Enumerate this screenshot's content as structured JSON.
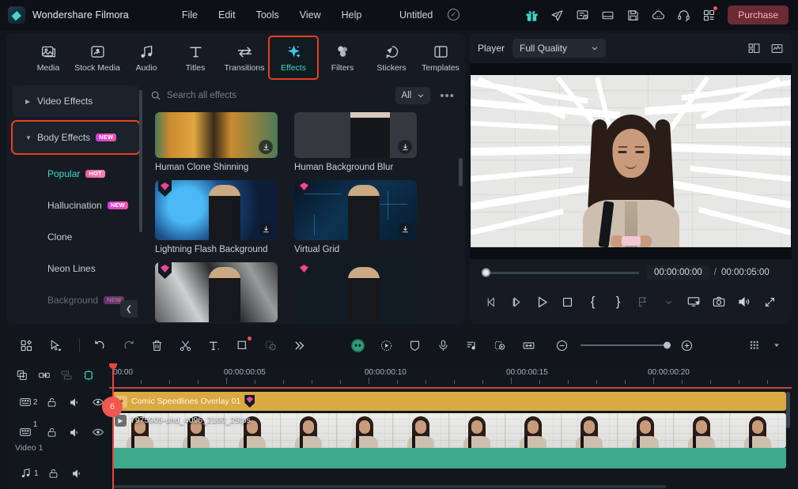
{
  "app": {
    "brand": "Wondershare Filmora",
    "logo_icon": "filmora-logo-icon",
    "menu": [
      "File",
      "Edit",
      "Tools",
      "View",
      "Help"
    ],
    "project_title": "Untitled",
    "project_saved_icon": "check-circle-icon",
    "top_icons": [
      {
        "name": "gift-icon",
        "label": "Gift"
      },
      {
        "name": "send-icon",
        "label": "Send"
      },
      {
        "name": "task-list-icon",
        "label": "Tasks"
      },
      {
        "name": "layout-icon",
        "label": "Layout"
      },
      {
        "name": "save-icon",
        "label": "Save"
      },
      {
        "name": "cloud-sync-icon",
        "label": "Cloud"
      },
      {
        "name": "headset-support-icon",
        "label": "Support"
      },
      {
        "name": "apps-grid-icon",
        "label": "More"
      }
    ],
    "purchase_label": "Purchase"
  },
  "tabs": [
    {
      "label": "Media",
      "icon": "media-icon",
      "active": false
    },
    {
      "label": "Stock Media",
      "icon": "stock-media-icon",
      "active": false
    },
    {
      "label": "Audio",
      "icon": "audio-icon",
      "active": false
    },
    {
      "label": "Titles",
      "icon": "titles-icon",
      "active": false
    },
    {
      "label": "Transitions",
      "icon": "transitions-icon",
      "active": false
    },
    {
      "label": "Effects",
      "icon": "effects-icon",
      "active": true
    },
    {
      "label": "Filters",
      "icon": "filters-icon",
      "active": false
    },
    {
      "label": "Stickers",
      "icon": "stickers-icon",
      "active": false
    },
    {
      "label": "Templates",
      "icon": "templates-icon",
      "active": false
    }
  ],
  "categories": [
    {
      "label": "Video Effects",
      "badge": "",
      "type": "group",
      "expanded": false
    },
    {
      "label": "Body Effects",
      "badge": "NEW",
      "type": "group",
      "expanded": true,
      "highlighted": true
    },
    {
      "label": "Popular",
      "badge": "HOT",
      "type": "sub",
      "selected": true
    },
    {
      "label": "Hallucination",
      "badge": "NEW",
      "type": "sub",
      "selected": false
    },
    {
      "label": "Clone",
      "badge": "",
      "type": "sub",
      "selected": false
    },
    {
      "label": "Neon Lines",
      "badge": "",
      "type": "sub",
      "selected": false
    },
    {
      "label": "Background",
      "badge": "NEW",
      "type": "sub",
      "selected": false
    }
  ],
  "collapse_icon": "chevron-left-icon",
  "search": {
    "placeholder": "Search all effects",
    "value": "",
    "icon": "search-icon",
    "filter_label": "All",
    "filter_caret": "chevron-down-icon",
    "more_label": "•••"
  },
  "effects": [
    {
      "name": "Human Clone Shinning",
      "thumb": "t-clone",
      "pro": false,
      "download": true
    },
    {
      "name": "Human Background Blur",
      "thumb": "t-blur",
      "pro": false,
      "download": true
    },
    {
      "name": "Lightning Flash Background",
      "thumb": "t-light",
      "pro": true,
      "download": true
    },
    {
      "name": "Virtual Grid",
      "thumb": "t-vgrid",
      "pro": true,
      "download": true
    },
    {
      "name": "",
      "thumb": "t-graff",
      "pro": true,
      "download": false
    },
    {
      "name": "",
      "thumb": "t-math",
      "pro": true,
      "download": false
    }
  ],
  "player": {
    "label": "Player",
    "quality": "Full Quality",
    "quality_caret": "chevron-down-icon",
    "head_icons": [
      {
        "name": "grid-layout-icon"
      },
      {
        "name": "waveform-scope-icon"
      }
    ],
    "current_time": "00:00:00:00",
    "separator": "/",
    "total_time": "00:00:05:00",
    "controls": [
      {
        "name": "previous-frame-button",
        "glyph": "prev"
      },
      {
        "name": "next-frame-button",
        "glyph": "next"
      },
      {
        "name": "play-button",
        "glyph": "play"
      },
      {
        "name": "stop-button",
        "glyph": "stop"
      },
      {
        "name": "mark-in-button",
        "glyph": "{"
      },
      {
        "name": "mark-out-button",
        "glyph": "}"
      },
      {
        "name": "export-frame-button",
        "glyph": "export"
      },
      {
        "name": "export-dropdown-button",
        "glyph": "caret"
      },
      {
        "name": "display-mode-button",
        "glyph": "display"
      },
      {
        "name": "snapshot-button",
        "glyph": "camera"
      },
      {
        "name": "volume-button",
        "glyph": "volume"
      },
      {
        "name": "fullscreen-button",
        "glyph": "fullscreen"
      }
    ]
  },
  "timeline_toolbar": {
    "left_tools": [
      {
        "name": "templates-panel-button",
        "glyph": "grid"
      },
      {
        "name": "selection-tool-button",
        "glyph": "cursor"
      },
      {
        "name": "divider",
        "glyph": "divider"
      },
      {
        "name": "undo-button",
        "glyph": "undo"
      },
      {
        "name": "redo-button",
        "glyph": "redo"
      },
      {
        "name": "delete-button",
        "glyph": "trash"
      },
      {
        "name": "split-button",
        "glyph": "scissors"
      },
      {
        "name": "text-tool-button",
        "glyph": "text"
      },
      {
        "name": "crop-tool-button",
        "glyph": "crop"
      },
      {
        "name": "mask-tool-button",
        "glyph": "mask"
      },
      {
        "name": "more-tools-button",
        "glyph": "chevrons"
      }
    ],
    "right_tools": [
      {
        "name": "ai-assistant-button",
        "glyph": "ai"
      },
      {
        "name": "motion-tracking-button",
        "glyph": "motion"
      },
      {
        "name": "keyframe-button",
        "glyph": "shield"
      },
      {
        "name": "voiceover-button",
        "glyph": "mic"
      },
      {
        "name": "audio-detach-button",
        "glyph": "audiolist"
      },
      {
        "name": "green-screen-button",
        "glyph": "chroma"
      },
      {
        "name": "fit-timeline-button",
        "glyph": "fit"
      },
      {
        "name": "zoom-out-button",
        "glyph": "minus"
      },
      {
        "name": "zoom-slider",
        "glyph": "slider"
      },
      {
        "name": "zoom-in-button",
        "glyph": "plus"
      },
      {
        "name": "track-manager-button",
        "glyph": "tracks"
      },
      {
        "name": "track-manager-caret",
        "glyph": "caret"
      }
    ]
  },
  "timeline": {
    "add_row_icons": [
      {
        "name": "add-track-button"
      },
      {
        "name": "link-clips-button"
      },
      {
        "name": "auto-arrange-button"
      },
      {
        "name": "marker-button"
      }
    ],
    "ruler_labels": [
      "00:00",
      "00:00:00:05",
      "00:00:00:10",
      "00:00:00:15",
      "00:00:00:20"
    ],
    "playhead_badge": "6",
    "tracks": [
      {
        "number": "2",
        "kind": "video",
        "name": "",
        "icons": [
          "track-video-icon",
          "lock-icon",
          "mute-icon",
          "eye-icon"
        ],
        "clip": {
          "name": "Comic Speedlines Overlay 01",
          "type": "effect",
          "pro": true
        }
      },
      {
        "number": "1",
        "kind": "video",
        "name": "Video 1",
        "icons": [
          "track-video-icon",
          "lock-icon",
          "mute-icon",
          "eye-icon"
        ],
        "clip": {
          "name": "7975905-uhd_4096_2160_25fps",
          "type": "video",
          "pro": false
        }
      },
      {
        "number": "1",
        "kind": "audio",
        "name": "",
        "icons": [
          "track-audio-icon",
          "lock-icon",
          "mute-icon"
        ],
        "clip": {
          "name": "",
          "type": "audio",
          "pro": false
        }
      }
    ]
  },
  "colors": {
    "accent_teal": "#3ddac4",
    "highlight_orange": "#e8401f",
    "playhead_red": "#e8453f",
    "overlay_clip": "#d9a942",
    "audio_clip": "#3fa98e",
    "purchase_bg": "#6b2a34",
    "panel_bg": "#161b23",
    "app_bg": "#0d1117"
  }
}
